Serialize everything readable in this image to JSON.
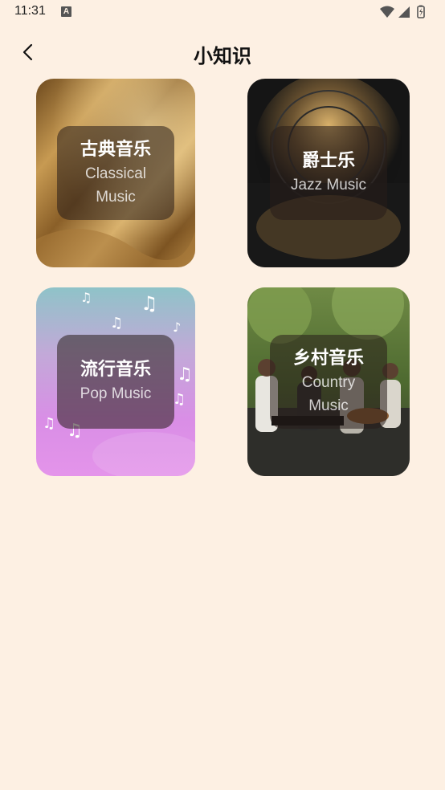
{
  "status_bar": {
    "time": "11:31",
    "notification_letter": "A"
  },
  "header": {
    "title": "小知识"
  },
  "cards": [
    {
      "title": "古典音乐",
      "subtitle": "Classical Music"
    },
    {
      "title": "爵士乐",
      "subtitle": "Jazz Music"
    },
    {
      "title": "流行音乐",
      "subtitle": "Pop Music"
    },
    {
      "title": "乡村音乐",
      "subtitle": "Country Music"
    }
  ]
}
